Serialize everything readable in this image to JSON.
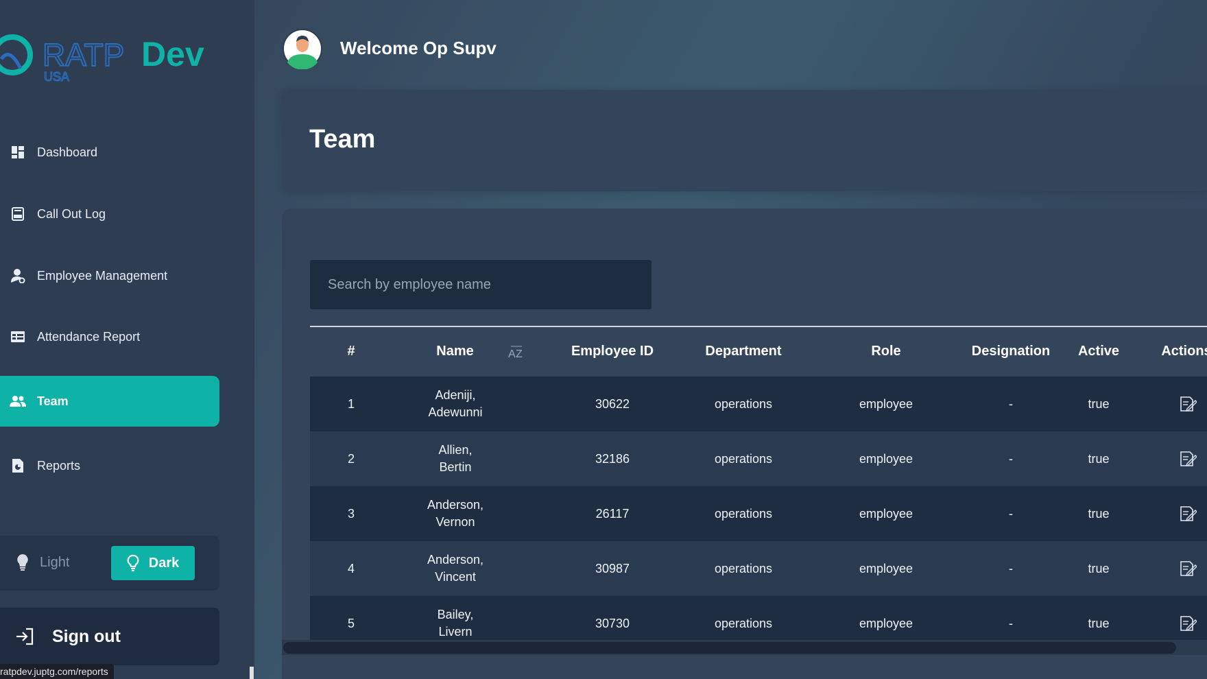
{
  "brand": {
    "name": "RATP",
    "dev": "Dev",
    "sub": "USA",
    "accent": "#0fb2a6"
  },
  "sidebar": {
    "items": [
      {
        "label": "Dashboard",
        "icon": "dashboard-icon"
      },
      {
        "label": "Call Out Log",
        "icon": "log-icon"
      },
      {
        "label": "Employee Management",
        "icon": "employee-management-icon"
      },
      {
        "label": "Attendance Report",
        "icon": "attendance-icon"
      },
      {
        "label": "Team",
        "icon": "team-icon",
        "active": true
      },
      {
        "label": "Reports",
        "icon": "report-icon"
      }
    ],
    "theme": {
      "light_label": "Light",
      "dark_label": "Dark",
      "selected": "Dark"
    },
    "signout_label": "Sign out"
  },
  "header": {
    "welcome": "Welcome Op Supv"
  },
  "page": {
    "title": "Team"
  },
  "search": {
    "placeholder": "Search by employee name",
    "value": ""
  },
  "table": {
    "columns": [
      "#",
      "Name",
      "Employee ID",
      "Department",
      "Role",
      "Designation",
      "Active",
      "Actions"
    ],
    "rows": [
      {
        "num": "1",
        "name_last": "Adeniji,",
        "name_first": "Adewunni",
        "id": "30622",
        "department": "operations",
        "role": "employee",
        "designation": "-",
        "active": "true"
      },
      {
        "num": "2",
        "name_last": "Allien,",
        "name_first": "Bertin",
        "id": "32186",
        "department": "operations",
        "role": "employee",
        "designation": "-",
        "active": "true"
      },
      {
        "num": "3",
        "name_last": "Anderson,",
        "name_first": "Vernon",
        "id": "26117",
        "department": "operations",
        "role": "employee",
        "designation": "-",
        "active": "true"
      },
      {
        "num": "4",
        "name_last": "Anderson,",
        "name_first": "Vincent",
        "id": "30987",
        "department": "operations",
        "role": "employee",
        "designation": "-",
        "active": "true"
      },
      {
        "num": "5",
        "name_last": "Bailey,",
        "name_first": "Livern",
        "id": "30730",
        "department": "operations",
        "role": "employee",
        "designation": "-",
        "active": "true"
      }
    ]
  },
  "status_bar": {
    "url": "ratpdev.juptg.com/reports"
  }
}
